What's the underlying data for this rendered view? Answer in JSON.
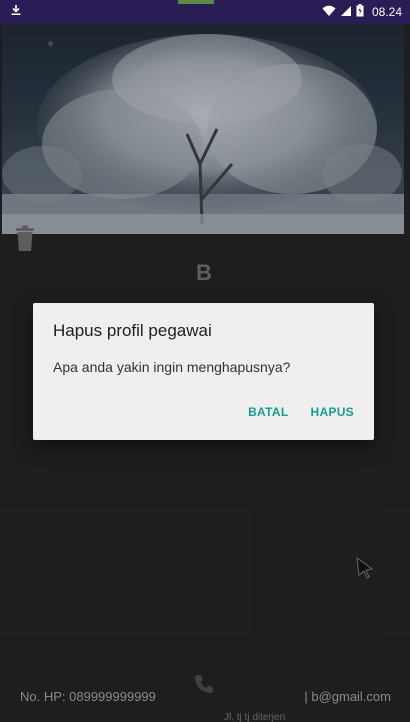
{
  "status_bar": {
    "time": "08.24",
    "download_icon": "download-icon",
    "wifi_icon": "wifi-icon",
    "signal_icon": "signal-icon",
    "battery_icon": "battery-icon"
  },
  "profile": {
    "initial": "B",
    "phone_text": "No. HP: 089999999999",
    "email_text": "| b@gmail.com",
    "footer_sub": "Jl. tj tj diterjen"
  },
  "dialog": {
    "title": "Hapus profil pegawai",
    "message": "Apa anda yakin ingin menghapusnya?",
    "cancel_label": "BATAL",
    "confirm_label": "HAPUS",
    "accent_color": "#1a9b8f"
  },
  "colors": {
    "status_bar": "#2a1c55",
    "background": "#232323",
    "dialog_bg": "#efefef"
  }
}
